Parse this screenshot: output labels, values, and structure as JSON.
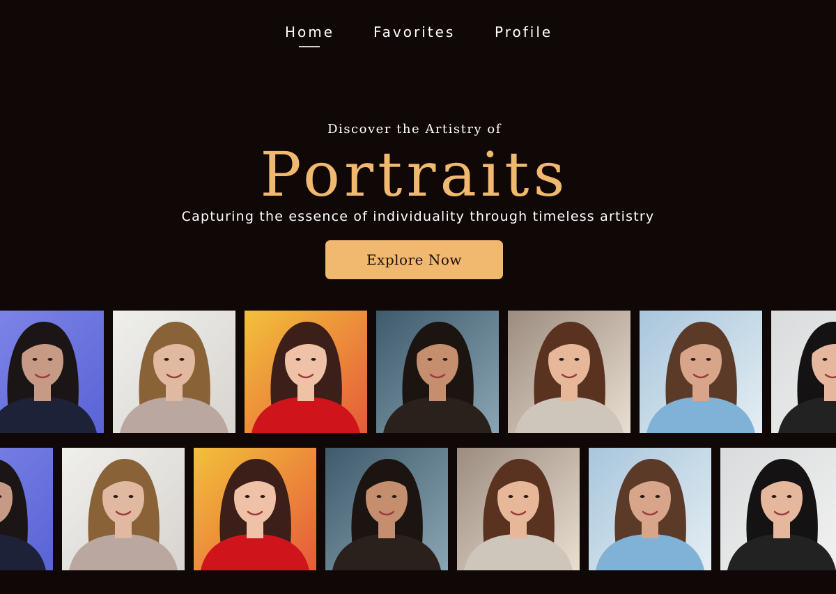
{
  "nav": {
    "items": [
      {
        "label": "Home",
        "active": true
      },
      {
        "label": "Favorites",
        "active": false
      },
      {
        "label": "Profile",
        "active": false
      }
    ]
  },
  "hero": {
    "kicker": "Discover the Artistry of",
    "title": "Portraits",
    "subtitle": "Capturing the essence of individuality through timeless artistry",
    "cta_label": "Explore Now"
  },
  "colors": {
    "background": "#100707",
    "accent": "#f0b96f",
    "text": "#ffffff"
  },
  "gallery": {
    "rows": 2,
    "portraits": [
      {
        "bg": "#7f86e8",
        "bg2": "#5a63d6",
        "skin": "#c79a86",
        "hair": "#1b1515",
        "cloth": "#1e2238",
        "name": "portrait-blue-studio"
      },
      {
        "bg": "#efefec",
        "bg2": "#d8d4cf",
        "skin": "#e0b9a0",
        "hair": "#8a6238",
        "cloth": "#b9a7a0",
        "name": "portrait-windblown-blonde"
      },
      {
        "bg": "#f2c13a",
        "bg2": "#e65a3a",
        "skin": "#efc2a8",
        "hair": "#3b1f18",
        "cloth": "#d0141c",
        "name": "portrait-red-dress"
      },
      {
        "bg": "#3f5a6a",
        "bg2": "#8aa6b5",
        "skin": "#c58e6e",
        "hair": "#1c1410",
        "cloth": "#2a211c",
        "name": "portrait-city-street"
      },
      {
        "bg": "#9c8c80",
        "bg2": "#e9dfd0",
        "skin": "#e6b798",
        "hair": "#5a3220",
        "cloth": "#cfc6bb",
        "name": "portrait-golden-hour"
      },
      {
        "bg": "#a8c6dc",
        "bg2": "#e5eef3",
        "skin": "#d8a58a",
        "hair": "#5c3a28",
        "cloth": "#7fb2d6",
        "name": "portrait-sky"
      },
      {
        "bg": "#d9dbdc",
        "bg2": "#f2f2f2",
        "skin": "#e5b89d",
        "hair": "#141212",
        "cloth": "#222222",
        "name": "portrait-flowing-hair"
      }
    ]
  }
}
